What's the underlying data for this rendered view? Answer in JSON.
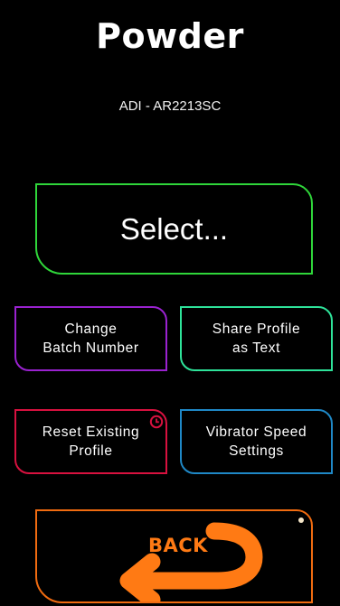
{
  "header": {
    "title": "Powder",
    "subtitle": "ADI - AR2213SC"
  },
  "buttons": {
    "select_label": "Select...",
    "change_batch_label": "Change\nBatch Number",
    "share_profile_label": "Share Profile\nas Text",
    "reset_profile_label": "Reset Existing\nProfile",
    "vibrator_speed_label": "Vibrator Speed\nSettings",
    "back_label": "BACK"
  },
  "colors": {
    "select_border": "#2fd63a",
    "change_batch_border": "#9a22d0",
    "share_profile_border": "#2ee39a",
    "reset_profile_border": "#d8113f",
    "vibrator_speed_border": "#1f88c6",
    "back_accent": "#f06b10"
  },
  "icons": {
    "reset_badge": "clock-icon",
    "back_arrow": "back-arrow-icon"
  }
}
